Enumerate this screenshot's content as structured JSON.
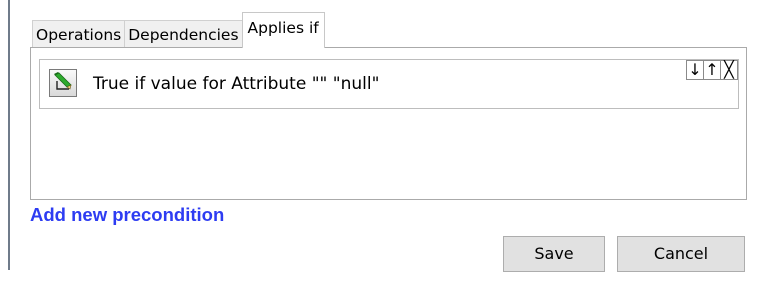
{
  "tabs": [
    {
      "label": "Operations",
      "active": false
    },
    {
      "label": "Dependencies",
      "active": false
    },
    {
      "label": "Applies if",
      "active": true
    }
  ],
  "condition": {
    "text": "True if value for Attribute \"\"  \"null\"",
    "controls": {
      "move_down": "↓",
      "move_up": "↑",
      "remove": "╳"
    },
    "edit_icon": "pencil-edit-icon"
  },
  "actions": {
    "add_precondition": "Add new precondition",
    "save": "Save",
    "cancel": "Cancel"
  },
  "colors": {
    "link": "#2d3cf2",
    "button_bg": "#e1e1e1",
    "tab_bg": "#f0f0f0"
  }
}
